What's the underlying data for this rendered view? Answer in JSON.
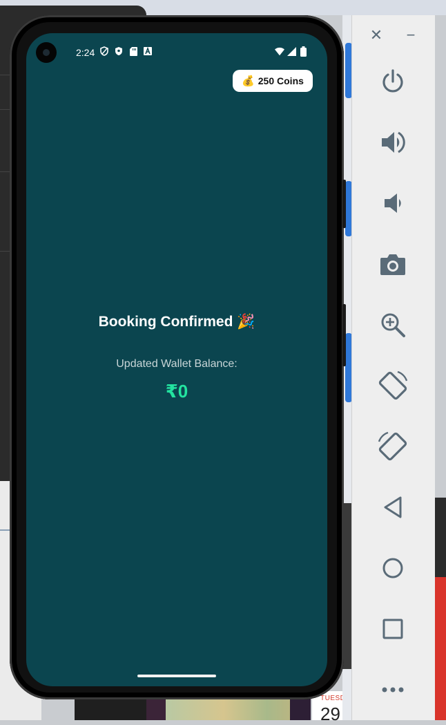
{
  "status_bar": {
    "time": "2:24",
    "left_icons": [
      "shield-outline-icon",
      "shield-icon",
      "sd-card-icon",
      "a-badge-icon"
    ],
    "right_icons": [
      "wifi-icon",
      "signal-icon",
      "battery-icon"
    ]
  },
  "header": {
    "coins_label": "250 Coins",
    "coins_emoji": "💰"
  },
  "main": {
    "title": "Booking Confirmed",
    "title_emoji": "🎉",
    "wallet_label": "Updated Wallet Balance:",
    "wallet_value": "₹0"
  },
  "background": {
    "calendar_day": "TUESD",
    "calendar_number": "29"
  },
  "emulator_toolbar": {
    "close_glyph": "✕",
    "minimize_glyph": "−",
    "buttons": [
      "power-icon",
      "volume-up-icon",
      "volume-down-icon",
      "camera-icon",
      "zoom-icon",
      "rotate-left-icon",
      "rotate-right-icon",
      "back-icon",
      "home-icon",
      "overview-icon",
      "more-icon"
    ]
  },
  "colors": {
    "screen_bg": "#0b454f",
    "wallet_value": "#23e3a0",
    "toolbar_icon": "#5a6b78"
  }
}
